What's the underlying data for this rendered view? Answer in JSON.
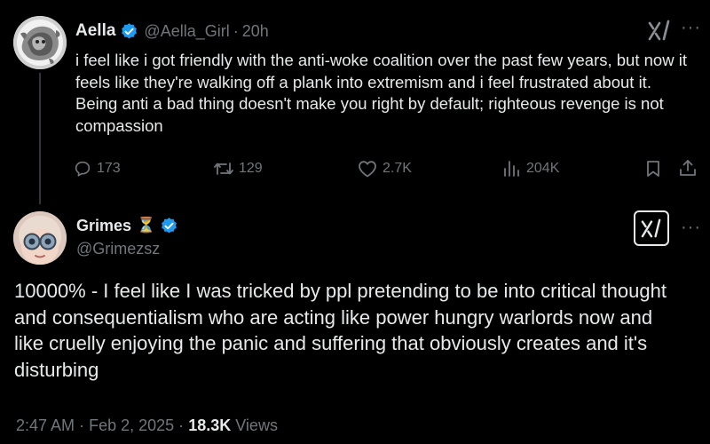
{
  "tweet1": {
    "display_name": "Aella",
    "handle": "@Aella_Girl",
    "separator": "·",
    "time": "20h",
    "text": "i feel like i got friendly with the anti-woke coalition over the past few years, but now it feels like they're walking off a plank into extremism and i feel frustrated about it. Being anti a bad thing doesn't make you right by default; righteous revenge is not compassion",
    "stats": {
      "replies": "173",
      "retweets": "129",
      "likes": "2.7K",
      "views": "204K"
    },
    "more_icon": "···"
  },
  "tweet2": {
    "display_name": "Grimes",
    "emoji": "⏳",
    "handle": "@Grimezsz",
    "text": "10000% - I feel like I was tricked by ppl pretending to be into critical thought and consequentialism who are acting like power hungry warlords now and like cruelly enjoying the panic and suffering that obviously creates and it's disturbing",
    "meta": {
      "time": "2:47 AM",
      "sep1": "·",
      "date": "Feb 2, 2025",
      "sep2": "·",
      "views_count": "18.3K",
      "views_label": "Views"
    },
    "more_icon": "···"
  },
  "colors": {
    "background": "#000000",
    "text": "#e7e9ea",
    "muted": "#71767b",
    "verified": "#1d9bf0",
    "thread_line": "#333639"
  },
  "icons": [
    "verified-badge-icon",
    "xai-logo-icon",
    "more-icon",
    "reply-icon",
    "retweet-icon",
    "like-icon",
    "views-icon",
    "bookmark-icon",
    "share-icon"
  ]
}
